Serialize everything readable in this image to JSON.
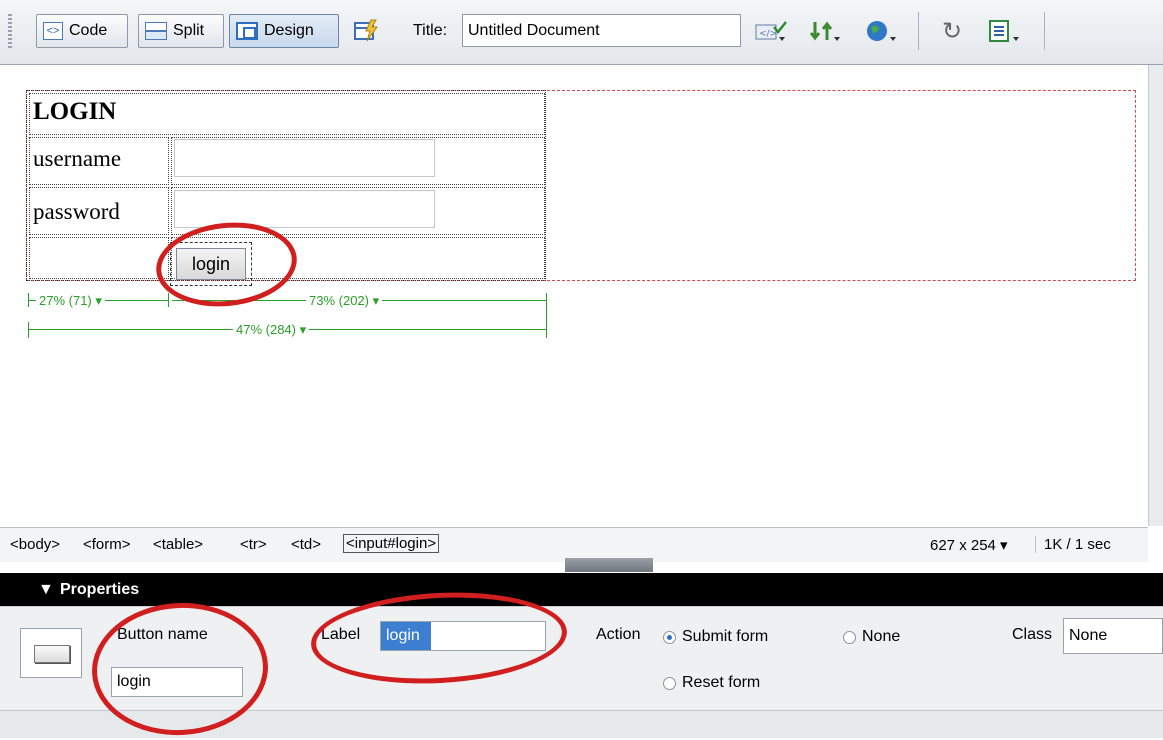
{
  "toolbar": {
    "code_label": "Code",
    "split_label": "Split",
    "design_label": "Design",
    "title_label": "Title:",
    "title_value": "Untitled Document",
    "icons": [
      "live-view-icon",
      "validate-markup-icon",
      "file-management-icon",
      "preview-browser-icon",
      "refresh-icon",
      "view-options-icon"
    ]
  },
  "design": {
    "heading": "LOGIN",
    "username_label": "username",
    "password_label": "password",
    "login_button": "login",
    "col1_width": "27% (71)",
    "col2_width": "73% (202)",
    "table_width": "47% (284)"
  },
  "tagbar": {
    "tags": [
      "<body>",
      "<form>",
      "<table>",
      "<tr>",
      "<td>",
      "<input#login>"
    ],
    "window_size": "627 x 254",
    "download": "1K / 1 sec"
  },
  "properties": {
    "header": "Properties",
    "button_name_label": "Button name",
    "button_name_value": "login",
    "label_label": "Label",
    "label_value": "login",
    "action_label": "Action",
    "submit_form": "Submit form",
    "reset_form": "Reset form",
    "none_option": "None",
    "class_label": "Class",
    "class_value": "None",
    "selected_action": "Submit form"
  },
  "colors": {
    "annotation_red": "#d11f1f",
    "table_width_green": "#2aa02a",
    "panel_header": "#000000"
  }
}
